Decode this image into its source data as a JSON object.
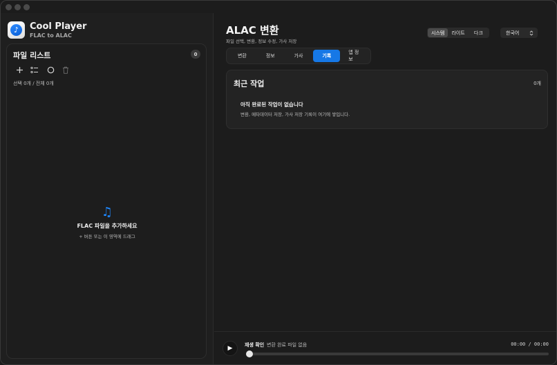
{
  "app": {
    "title": "Cool Player",
    "subtitle": "FLAC to ALAC",
    "icon": "music-note-icon"
  },
  "colors": {
    "accent": "#1678e6",
    "background": "#1c1c1c",
    "panel": "#232323"
  },
  "file_list": {
    "title": "파일 리스트",
    "count": "0",
    "selection_text": "선택 0개 / 전체 0개",
    "tools": [
      "plus-icon",
      "checklist-icon",
      "circle-icon",
      "trash-icon"
    ],
    "empty": {
      "icon": "music-note-icon",
      "title": "FLAC 파일을 추가하세요",
      "subtitle": "+ 버튼 또는 이 영역에 드래그"
    }
  },
  "header": {
    "title": "ALAC 변환",
    "subtitle": "파일 선택, 변환, 정보 수정, 가사 저장",
    "theme_options": [
      "시스템",
      "라이트",
      "다크"
    ],
    "theme_selected": "시스템",
    "language": "한국어"
  },
  "tabs": [
    {
      "label": "변환",
      "active": false
    },
    {
      "label": "정보",
      "active": false
    },
    {
      "label": "가사",
      "active": false
    },
    {
      "label": "기록",
      "active": true
    },
    {
      "label": "앱 정보",
      "active": false
    }
  ],
  "recent": {
    "title": "최근 작업",
    "count": "0개",
    "empty_title": "아직 완료된 작업이 없습니다",
    "empty_subtitle": "변환, 메타데이터 저장, 가사 저장 기록이 여기에 쌓입니다."
  },
  "player": {
    "label": "재생 확인",
    "status": "변환 완료 파일 없음",
    "time": "00:00 / 00:00",
    "progress": 0
  }
}
